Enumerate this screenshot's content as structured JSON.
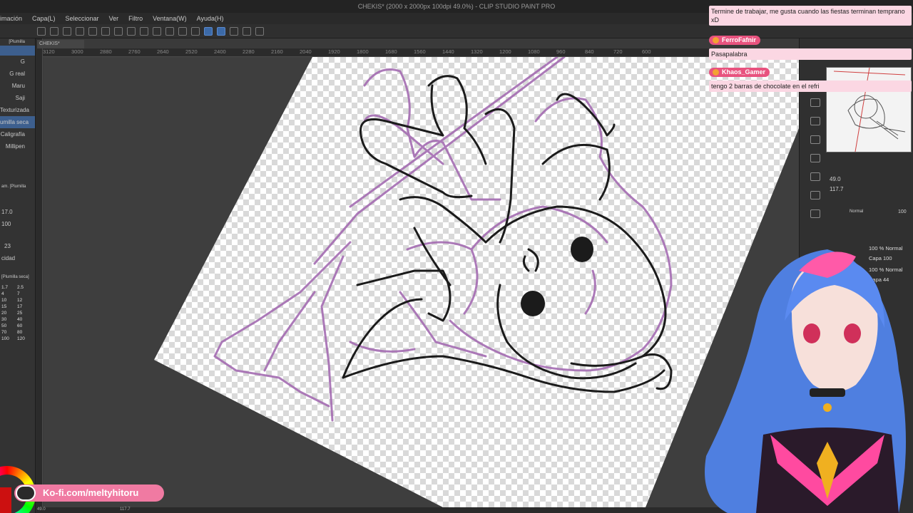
{
  "window": {
    "title": "CHEKIS* (2000 x 2000px 100dpi 49.0%) - CLIP STUDIO PAINT PRO"
  },
  "menu": [
    "imación",
    "Capa(L)",
    "Seleccionar",
    "Ver",
    "Filtro",
    "Ventana(W)",
    "Ayuda(H)"
  ],
  "document_tab": "CHEKIS*",
  "ruler_h": [
    "3120",
    "3000",
    "2880",
    "2760",
    "2640",
    "2520",
    "2400",
    "2280",
    "2160",
    "2040",
    "1920",
    "1800",
    "1680",
    "1560",
    "1440",
    "1320",
    "1200",
    "1080",
    "960",
    "840",
    "720",
    "600"
  ],
  "left_panel": {
    "items": [
      "[Plumilla",
      "",
      "G",
      "G real",
      "Maru",
      "Saji",
      "Texturizada",
      "umilla seca",
      "Caligrafía",
      "Millipen"
    ],
    "selected_index": 7,
    "brush_label": "am. [Plumilla",
    "size": "17.0",
    "opacity": "100",
    "density": "23",
    "density_label": "cidad",
    "sizes_header": "[Plumilla seca]",
    "size_values": [
      "1.7",
      "2.5",
      "4",
      "7",
      "10",
      "12",
      "15",
      "17",
      "20",
      "25",
      "30",
      "40",
      "50",
      "60",
      "70",
      "80",
      "100",
      "120"
    ]
  },
  "right_panel": {
    "navigator_zoom": "49.0",
    "navigator_angle": "117.7",
    "layer_blend": "Normal",
    "layer_opacity": "100",
    "layers": [
      {
        "label": "100 % Normal"
      },
      {
        "label": "Capa 100"
      },
      {
        "label": "100 % Normal"
      },
      {
        "label": "Capa 44"
      }
    ]
  },
  "bottom": {
    "zoom": "49.0",
    "angle": "117.7"
  },
  "chat": {
    "messages": [
      {
        "user": "",
        "text": "Termine de trabajar, me gusta cuando las fiestas terminan temprano xD"
      },
      {
        "user": "FerroFafnir",
        "text": "Pasapalabra"
      },
      {
        "user": "Khaos_Gamer",
        "text": "tengo 2 barras de chocolate en el refri"
      }
    ]
  },
  "overlay": {
    "kofi": "Ko-fi.com/meltyhitoru"
  },
  "colors": {
    "sketch_purple": "#a46cb2",
    "lineart": "#1b1b1b",
    "chat_bubble": "#fbd7e3",
    "chat_name": "#e8537f",
    "kofi": "#f07aa2",
    "selection": "#3d5f8e"
  }
}
